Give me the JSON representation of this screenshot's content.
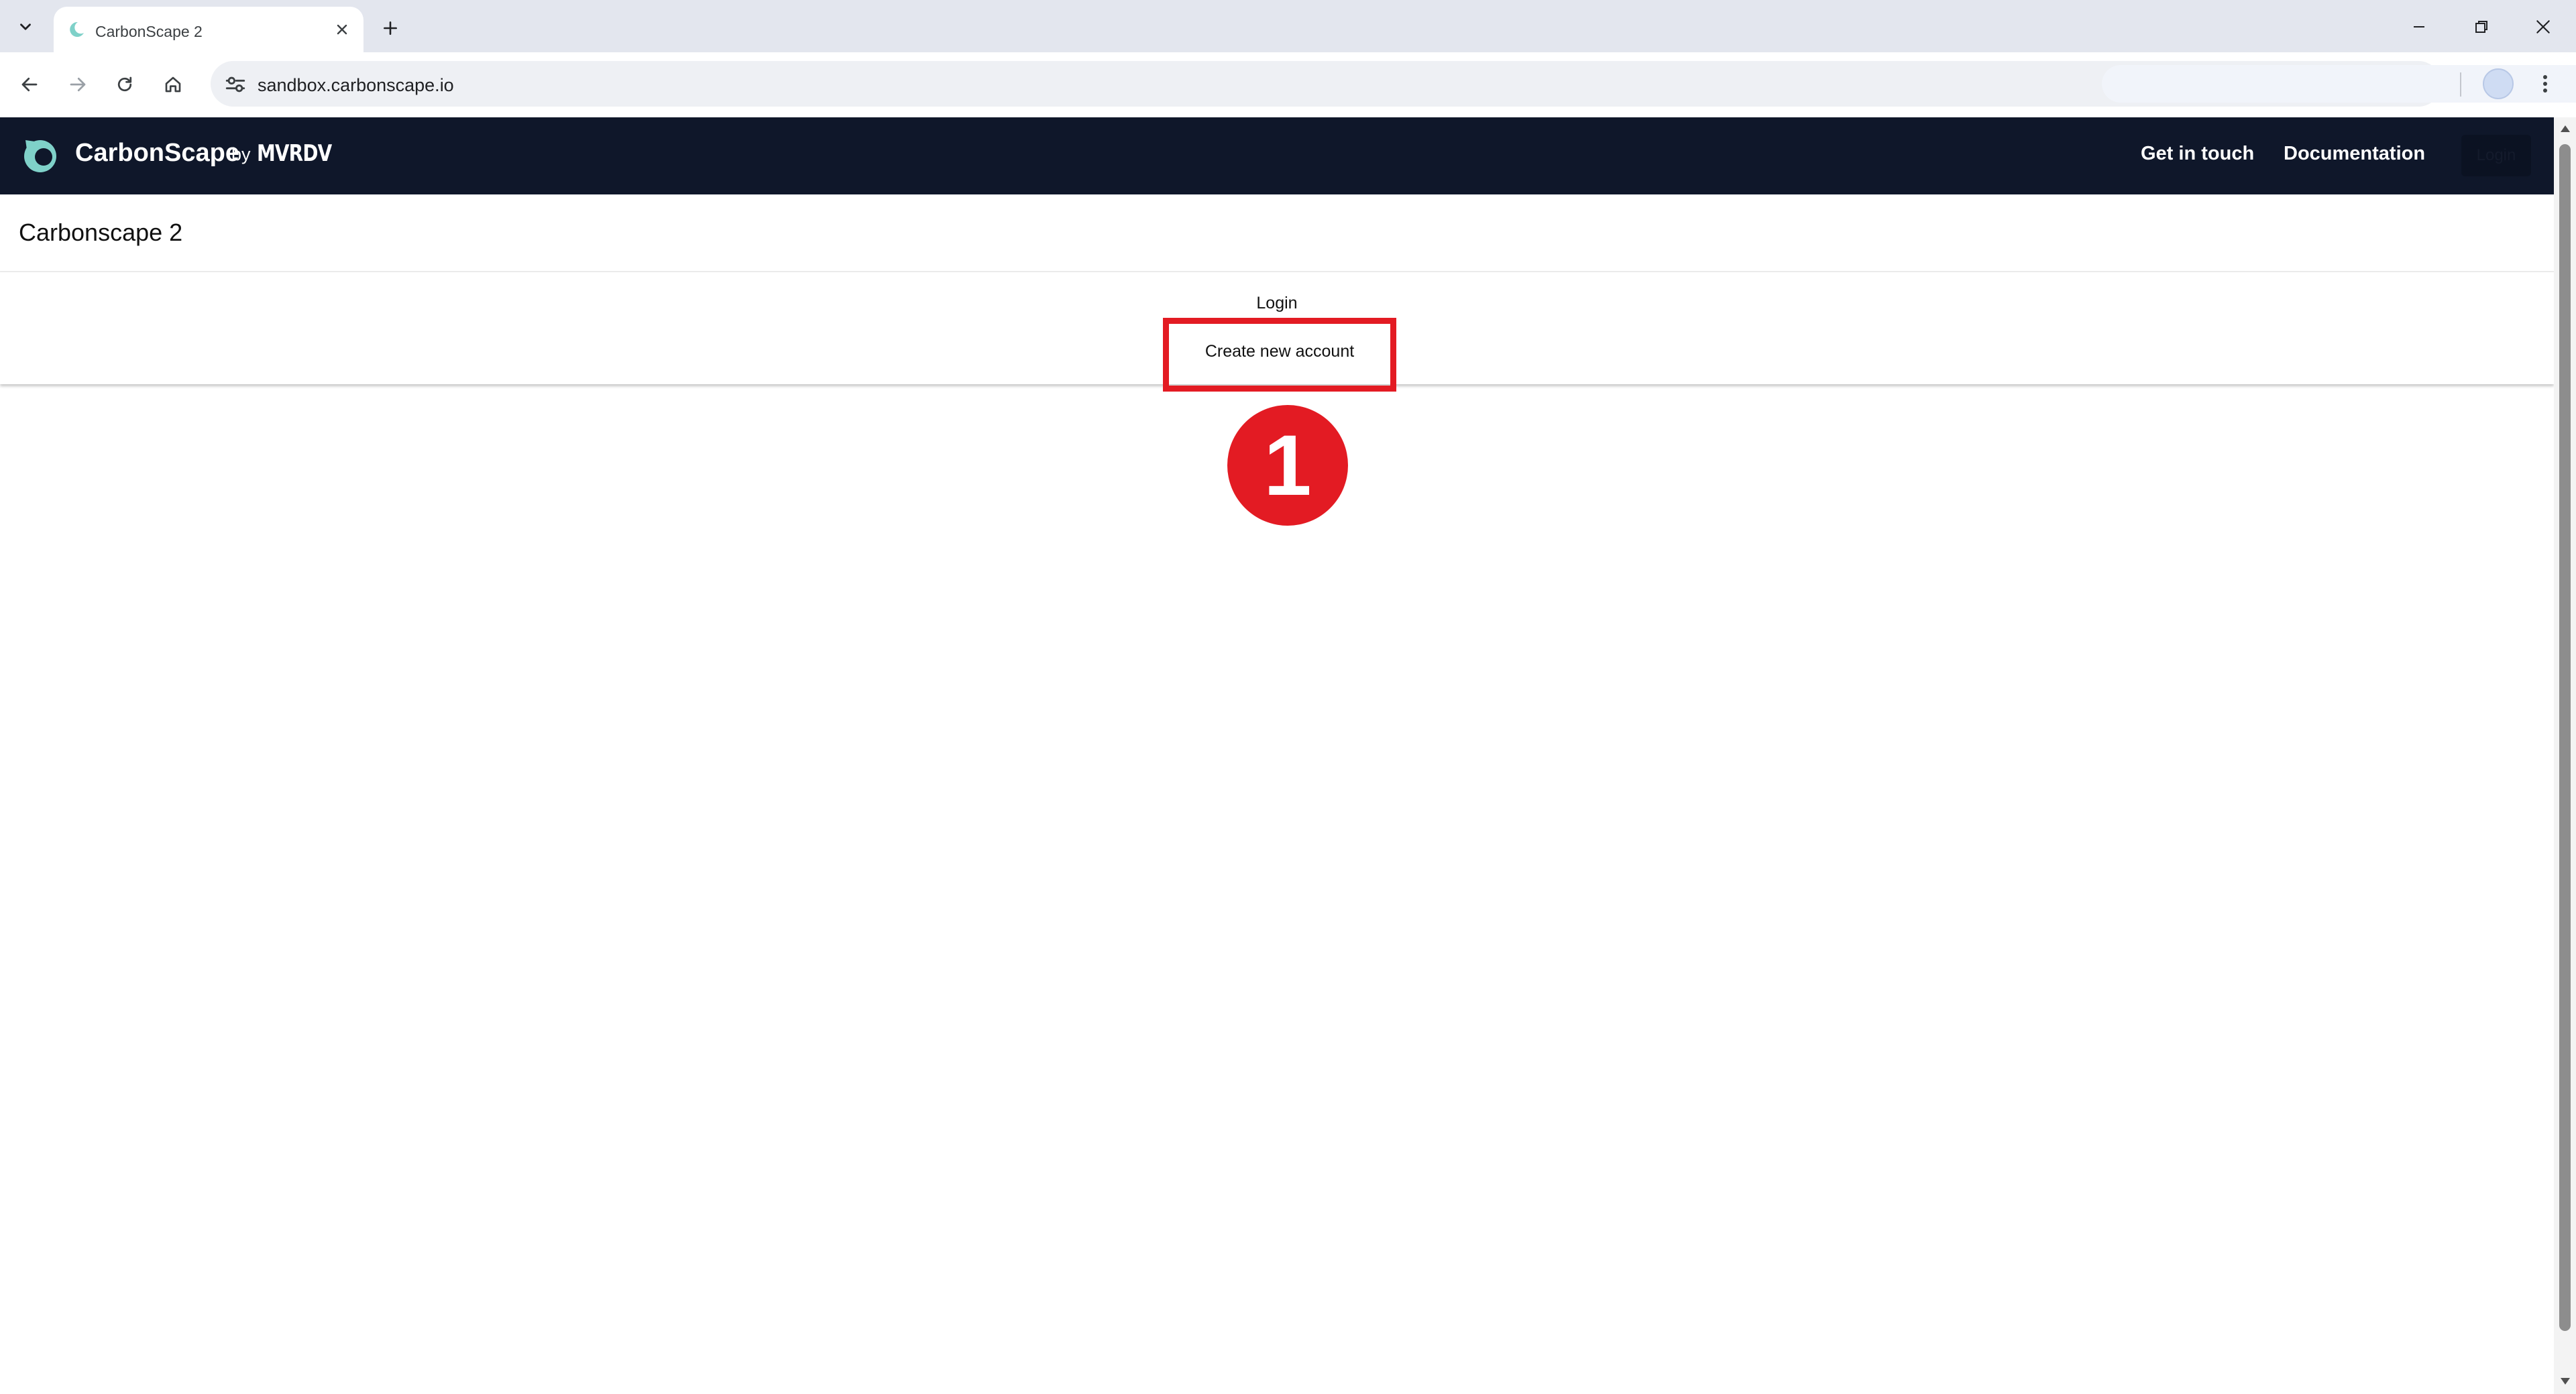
{
  "browser": {
    "tab_title": "CarbonScape 2",
    "url": "sandbox.carbonscape.io",
    "icons": {
      "tab_search": "chevron-down-icon",
      "tab_close": "close-icon",
      "new_tab": "plus-icon",
      "minimize": "minimize-icon",
      "restore": "restore-icon",
      "close_window": "close-icon",
      "back": "arrow-left-icon",
      "forward": "arrow-right-icon",
      "reload": "reload-icon",
      "home": "home-icon",
      "site_info": "tune-icon",
      "profile": "avatar",
      "menu": "kebab-icon"
    }
  },
  "header": {
    "brand": "CarbonScape",
    "brand_by": "by",
    "brand_partner": "MVRDV",
    "nav": {
      "get_in_touch": "Get in touch",
      "documentation": "Documentation",
      "login": "Login"
    },
    "background": "#0f172a"
  },
  "page": {
    "title": "Carbonscape 2",
    "login_link": "Login",
    "create_account": "Create new account"
  },
  "annotation": {
    "step_number": "1",
    "color": "#e31b23"
  }
}
